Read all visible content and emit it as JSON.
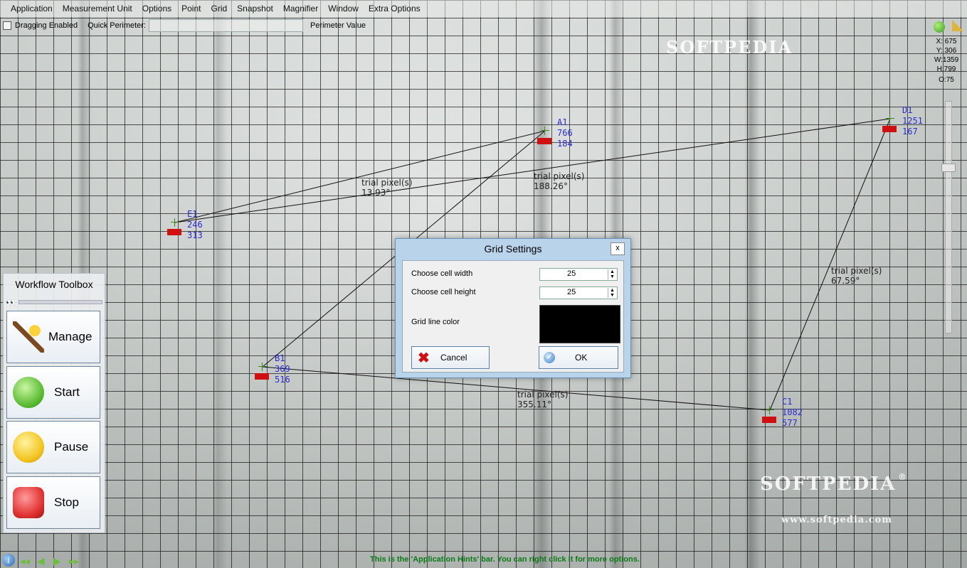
{
  "menu": {
    "items": [
      "Application",
      "Measurement Unit",
      "Options",
      "Point",
      "Grid",
      "Snapshot",
      "Magnifier",
      "Window",
      "Extra Options"
    ]
  },
  "toolbar": {
    "dragging_label": "Dragging Enabled",
    "quick_perimeter_label": "Quick Perimeter:",
    "quick_perimeter_value": "",
    "perimeter_value_label": "Perimeter Value"
  },
  "status": {
    "x": "X: 675",
    "y": "Y: 306",
    "w": "W:1359",
    "h": "H:799",
    "o": "O:75"
  },
  "watermarks": {
    "top": "SOFTPEDIA",
    "bottom": "SOFTPEDIA",
    "registered": "®",
    "url": "www.softpedia.com"
  },
  "points": [
    {
      "name": "A1",
      "x": "766",
      "y": "184"
    },
    {
      "name": "D1",
      "x": "1251",
      "y": "167"
    },
    {
      "name": "E1",
      "x": "246",
      "y": "313"
    },
    {
      "name": "B1",
      "x": "369",
      "y": "516"
    },
    {
      "name": "C1",
      "x": "1082",
      "y": "577"
    }
  ],
  "segments": [
    {
      "unit": "trial pixel(s)",
      "angle": "13.93°"
    },
    {
      "unit": "trial pixel(s)",
      "angle": "188.26°"
    },
    {
      "unit": "trial pixel(s)",
      "angle": "67.59°"
    },
    {
      "unit": "trial pixel(s)",
      "angle": "355.11°"
    }
  ],
  "toolbox": {
    "title": "Workflow Toolbox",
    "buttons": [
      "Manage",
      "Start",
      "Pause",
      "Stop"
    ]
  },
  "dialog": {
    "title": "Grid Settings",
    "close": "x",
    "cell_width_label": "Choose cell width",
    "cell_width_value": "25",
    "cell_height_label": "Choose cell height",
    "cell_height_value": "25",
    "line_color_label": "Grid line color",
    "line_color": "#000000",
    "cancel_label": "Cancel",
    "ok_label": "OK"
  },
  "hints": {
    "text": "This is the 'Application Hints' bar. You can right click it for more options."
  }
}
